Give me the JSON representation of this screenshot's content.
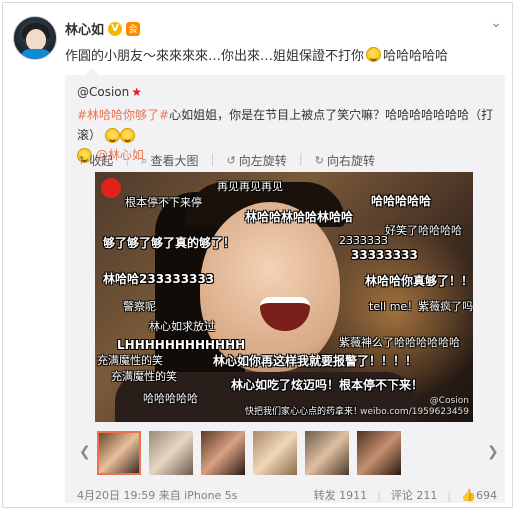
{
  "post": {
    "user_name": "林心如",
    "verified_label": "V",
    "tag_label": "会",
    "text_before": "作圓的小朋友～來來來來…你出來…姐姐保證不打你",
    "text_after": "哈哈哈哈哈"
  },
  "repost": {
    "original_user": "@Cosion",
    "hashtag": "#林哈哈你够了#",
    "text": "心如姐姐，你是在节目上被点了笑穴嘛？哈哈哈哈哈哈哈（打滚）",
    "mention": "@林心如",
    "toolbar": {
      "collapse_label": "收起",
      "view_large_label": "查看大图",
      "rotate_left_label": "向左旋转",
      "rotate_right_label": "向右旋转"
    },
    "image_overlays": [
      "再见再见再见",
      "哈哈哈哈哈",
      "根本停不下来停",
      "林哈哈林哈哈林哈哈",
      "好笑了哈哈哈哈",
      "够了够了够了真的够了！",
      "2333333",
      "33333333",
      "林哈哈233333333",
      "林哈哈你真够了！！！",
      "警察呢",
      "tell me！紫薇疯了吗",
      "林心如求放过",
      "LHHHHHHHHHHHH",
      "紫薇神么了哈哈哈哈哈哈",
      "充满魔性的笑",
      "林心如你再这样我就要报警了！！！！",
      "充满魔性的笑",
      "林心如吃了炫迈吗！根本停不下来！",
      "哈哈哈哈哈",
      "快把我们家心心点的药拿来！"
    ],
    "watermark_line1": "@Cosion",
    "watermark_line2": "weibo.com/1959623459",
    "footer": {
      "timestamp": "4月20日 19:59 来自 iPhone 5s",
      "forward_label": "转发 1911",
      "comment_label": "评论 211",
      "like_count": "694"
    }
  },
  "ui": {
    "menu_icon": "chevron-down-icon",
    "accent_color": "#eb7350",
    "link_color": "#eb7350"
  }
}
